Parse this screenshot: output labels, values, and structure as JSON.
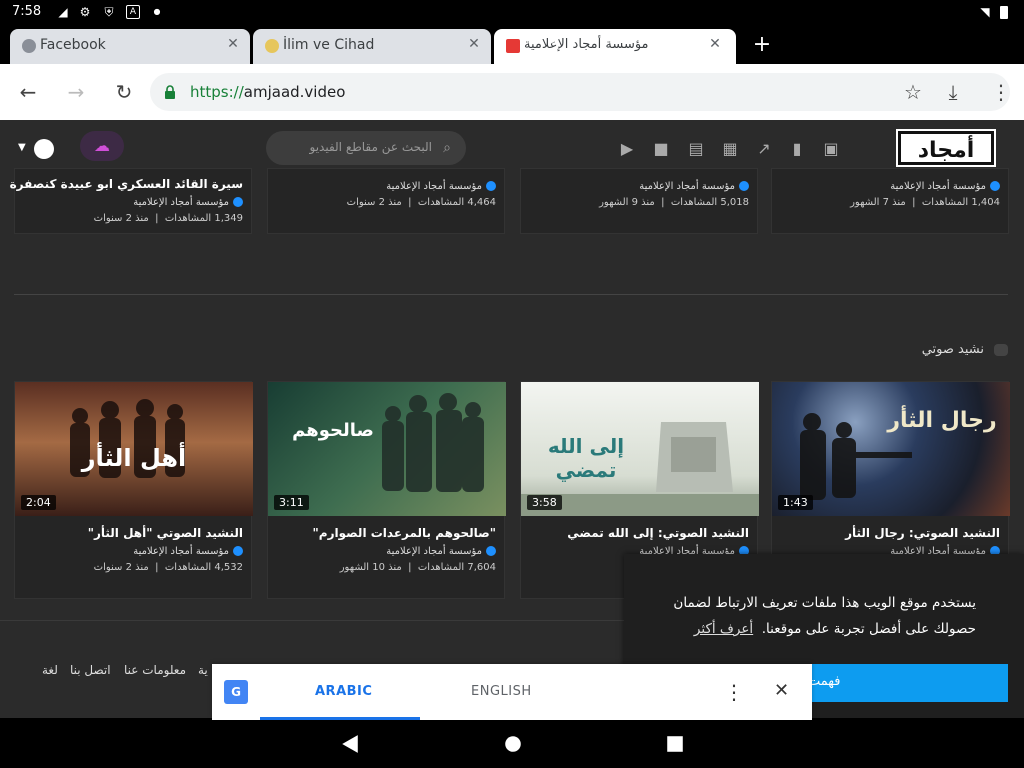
{
  "status": {
    "time": "7:58",
    "icons": [
      "signal-icon",
      "gear-icon",
      "shield-icon",
      "a-icon",
      "dot-icon",
      "wifi-icon",
      "battery-icon"
    ]
  },
  "tabs": [
    {
      "label": "Facebook",
      "icon": "facebook-favicon",
      "active": false
    },
    {
      "label": "İlim ve Cihad",
      "icon": "bell-favicon",
      "active": false
    },
    {
      "label": "مؤسسة أمجاد الإعلامية",
      "icon": "play-favicon",
      "active": true
    }
  ],
  "newtab": "+",
  "toolbar": {
    "url_scheme": "https://",
    "url_host": "amjaad.video"
  },
  "site": {
    "logo": "أمجاد",
    "search_placeholder": "البحث عن مقاطع الفيديو"
  },
  "top_row": [
    {
      "title": "سيرة القائد العسكري ابو عبيدة كنصفرة",
      "channel": "مؤسسة أمجاد الإعلامية",
      "views": "1,349 المشاهدات",
      "age": "منذ 2 سنوات"
    },
    {
      "title": "",
      "channel": "مؤسسة أمجاد الإعلامية",
      "views": "4,464 المشاهدات",
      "age": "منذ 2 سنوات"
    },
    {
      "title": "",
      "channel": "مؤسسة أمجاد الإعلامية",
      "views": "5,018 المشاهدات",
      "age": "منذ 9 الشهور"
    },
    {
      "title": "",
      "channel": "مؤسسة أمجاد الإعلامية",
      "views": "1,404 المشاهدات",
      "age": "منذ 7 الشهور"
    }
  ],
  "section_label": "نشيد صوتي",
  "videos": [
    {
      "title": "النشيد الصوتي \"أهل الثأر\"",
      "channel": "مؤسسة أمجاد الإعلامية",
      "views": "4,532 المشاهدات",
      "age": "منذ 2 سنوات",
      "duration": "2:04",
      "thumb_text": "أهل الثأر",
      "colors": [
        "#6b3a2a",
        "#c47a48"
      ]
    },
    {
      "title": "\"صالحوهم بالمرعدات الصوارم\"",
      "channel": "مؤسسة أمجاد الإعلامية",
      "views": "7,604 المشاهدات",
      "age": "منذ 10 الشهور",
      "duration": "3:11",
      "thumb_text": "صالحوهم",
      "colors": [
        "#1e4a3c",
        "#5e8a5c"
      ]
    },
    {
      "title": "النشيد الصوتي: إلى الله تمضي",
      "channel": "مؤسسة أمجاد الإعلامية",
      "views": "",
      "age": "",
      "duration": "3:58",
      "thumb_text": "إلى الله تمضي",
      "colors": [
        "#e8ece6",
        "#c8cfc2"
      ]
    },
    {
      "title": "النشيد الصوتي: رجال الثأر",
      "channel": "مؤسسة أمجاد الإعلامية",
      "views": "",
      "age": "",
      "duration": "1:43",
      "thumb_text": "رجال الثأر",
      "colors": [
        "#1c2a44",
        "#6a4a3a"
      ]
    }
  ],
  "footer_links": [
    "لغة",
    "اتصل بنا",
    "معلومات عنا",
    "ية"
  ],
  "cookie": {
    "text": "يستخدم موقع الويب هذا ملفات تعريف الارتباط لضمان حصولك على أفضل تجربة على موقعنا.",
    "learn_more": "أعرف أكثر",
    "ok": "فهمت"
  },
  "translate": {
    "lang_source": "ARABIC",
    "lang_target": "ENGLISH"
  }
}
